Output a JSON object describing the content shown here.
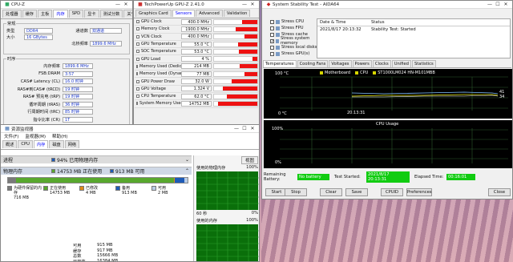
{
  "cpuz": {
    "title": "CPU-Z",
    "tabs": [
      "处理器",
      "缓存",
      "主板",
      "内存",
      "SPD",
      "显卡",
      "测试分数",
      "关于"
    ],
    "active_tab": "内存",
    "general_legend": "常规",
    "type_label": "类型",
    "type_value": "DDR4",
    "size_label": "大小",
    "size_value": "16 GBytes",
    "channel_label": "通道数",
    "channel_value": "双通道",
    "nb_freq_label": "北桥频率",
    "nb_freq_value": "1899.6 MHz",
    "timing_legend": "时序",
    "timings": [
      {
        "label": "内存频率",
        "value": "1899.6 MHz"
      },
      {
        "label": "FSB:DRAM",
        "value": "3:57"
      },
      {
        "label": "CAS# Latency (CL)",
        "value": "16.0 时钟"
      },
      {
        "label": "RAS#到CAS# (tRCD)",
        "value": "19 时钟"
      },
      {
        "label": "RAS# 预充电 (tRP)",
        "value": "19 时钟"
      },
      {
        "label": "循环周期 (tRAS)",
        "value": "36 时钟"
      },
      {
        "label": "行周期时间 (tRC)",
        "value": "85 时钟"
      },
      {
        "label": "指令比率 (CR)",
        "value": "1T"
      }
    ]
  },
  "gpuz": {
    "title": "TechPowerUp GPU-Z 2.41.0",
    "tabs": [
      "Graphics Card",
      "Sensors",
      "Advanced",
      "Validation"
    ],
    "active_tab": "Sensors",
    "sensors": [
      {
        "name": "GPU Clock",
        "value": "400.0 MHz",
        "fill": 0.35
      },
      {
        "name": "Memory Clock",
        "value": "1900.0 MHz",
        "fill": 0.5
      },
      {
        "name": "VCN Clock",
        "value": "400.0 MHz",
        "fill": 0.3
      },
      {
        "name": "GPU Temperature",
        "value": "55.0 °C",
        "fill": 0.45
      },
      {
        "name": "SOC Temperature",
        "value": "53.0 °C",
        "fill": 0.42
      },
      {
        "name": "GPU Load",
        "value": "4 %",
        "fill": 0.12
      },
      {
        "name": "Memory Used (Dedicated)",
        "value": "214 MB",
        "fill": 0.4
      },
      {
        "name": "Memory Used (Dynamic)",
        "value": "77 MB",
        "fill": 0.3
      },
      {
        "name": "GPU Power Draw",
        "value": "32.0 W",
        "fill": 0.6
      },
      {
        "name": "GPU Voltage",
        "value": "1.324 V",
        "fill": 0.8
      },
      {
        "name": "CPU Temperature",
        "value": "62.0 °C",
        "fill": 0.7
      },
      {
        "name": "System Memory Used",
        "value": "14752 MB",
        "fill": 0.9
      }
    ]
  },
  "aida": {
    "title": "System Stability Test - AIDA64",
    "stress_items": [
      "Stress CPU",
      "Stress FPU",
      "Stress cache",
      "Stress system memory",
      "Stress local disks",
      "Stress GPU(s)"
    ],
    "stress_checked": [
      false,
      false,
      false,
      true,
      false,
      false
    ],
    "log_headers": [
      "Date & Time",
      "Status"
    ],
    "log_row": {
      "datetime": "2021/8/17 20:13:32",
      "status": "Stability Test: Started"
    },
    "tabs": [
      "Temperatures",
      "Cooling Fans",
      "Voltages",
      "Powers",
      "Clocks",
      "Unified",
      "Statistics"
    ],
    "active_tab": "Temperatures",
    "legend_items": [
      "Motherboard",
      "CPU",
      "ST1000LM024 HN-M101MBB"
    ],
    "temp_graph": {
      "y_top": "100 °C",
      "y_bottom": "0 °C",
      "time_label": "20:13:31",
      "right_values": [
        "41",
        "34"
      ]
    },
    "cpu_usage_title": "CPU Usage",
    "usage_graph": {
      "y_top": "100%",
      "y_bottom": "0%"
    },
    "remaining_battery_label": "Remaining Battery:",
    "remaining_battery_value": "No battery",
    "test_started_label": "Test Started:",
    "test_started_value": "2021/8/17 20:13:31",
    "elapsed_label": "Elapsed Time:",
    "elapsed_value": "00:16:01",
    "buttons": [
      "Start",
      "Stop",
      "Clear",
      "Save",
      "CPUID",
      "Preferences",
      "Close"
    ],
    "colors": {
      "graph_bg": "#000000",
      "grid": "#2c5a2c",
      "legend_check": "#d6d600",
      "usage_fill": "#35b535"
    }
  },
  "resmon": {
    "title": "资源监视器",
    "menu": [
      "文件(F)",
      "监视器(M)",
      "帮助(H)"
    ],
    "tabs": [
      "概述",
      "CPU",
      "内存",
      "磁盘",
      "网络"
    ],
    "active_tab": "内存",
    "process_section": {
      "label": "进程",
      "stat": "94% 已用物理内存"
    },
    "memory_section": {
      "label": "物理内存",
      "stat1": "14753 MB 正在使用",
      "stat2": "913 MB 可用"
    },
    "legend": [
      {
        "label": "为硬件保留的内存",
        "value": "716 MB",
        "color": "#7a7a7a"
      },
      {
        "label": "正在使用",
        "value": "14753 MB",
        "color": "#58a82e"
      },
      {
        "label": "已修改",
        "value": "4 MB",
        "color": "#e08a1a"
      },
      {
        "label": "备用",
        "value": "913 MB",
        "color": "#1e5bb8"
      },
      {
        "label": "可用",
        "value": "2 MB",
        "color": "#b9cce6"
      }
    ],
    "usage_bar": {
      "hardware": 0.044,
      "inuse": 0.88,
      "modified": 0.003,
      "standby": 0.057,
      "free": 0.016
    },
    "stats": [
      {
        "label": "可用",
        "value": "915 MB"
      },
      {
        "label": "缓存",
        "value": "917 MB"
      },
      {
        "label": "总数",
        "value": "15666 MB"
      },
      {
        "label": "已安装",
        "value": "16384 MB"
      }
    ],
    "view_label": "视图",
    "chart1_title": "使用的物理内存",
    "chart1_top": "100%",
    "chart1_bottom_left": "60 秒",
    "chart1_bottom_right": "0%",
    "chart2_title": "使用的内存",
    "chart2_top": "100%",
    "colors": {
      "inuse": "#58a82e",
      "chart_bg": "#0a6f0a"
    }
  }
}
